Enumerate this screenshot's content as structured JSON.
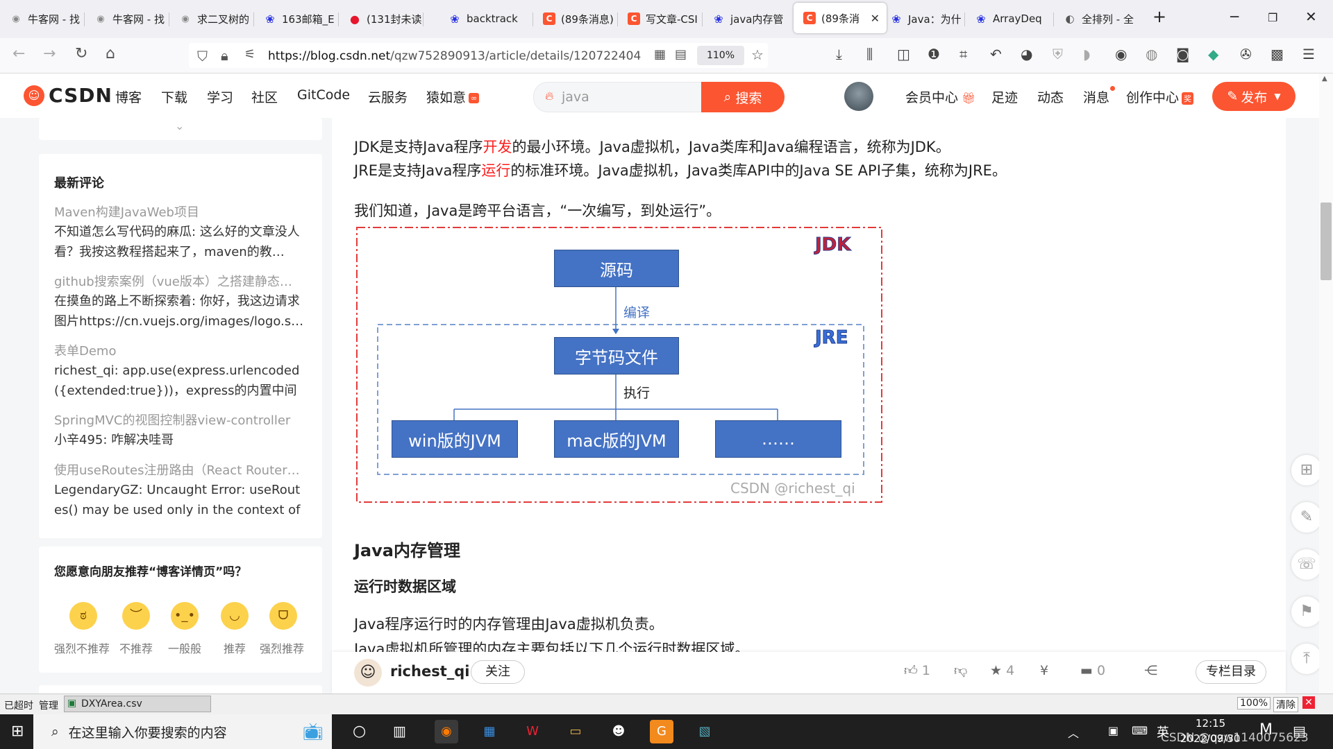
{
  "browser": {
    "tabs": [
      {
        "title": "牛客网 - 找",
        "icon": "nowcoder-icon"
      },
      {
        "title": "牛客网 - 找",
        "icon": "nowcoder-icon"
      },
      {
        "title": "求二叉树的",
        "icon": "nowcoder-icon"
      },
      {
        "title": "163邮箱_Е",
        "icon": "paw-icon"
      },
      {
        "title": "(131封未读",
        "icon": "weibo-icon"
      },
      {
        "title": "backtrack",
        "icon": "paw-icon"
      },
      {
        "title": "(89条消息)",
        "icon": "csdn-icon"
      },
      {
        "title": "写文章-CSI",
        "icon": "csdn-icon"
      },
      {
        "title": "java内存管",
        "icon": "paw-icon"
      },
      {
        "title": "(89条消",
        "icon": "csdn-icon",
        "active": true
      },
      {
        "title": "Java：为什",
        "icon": "paw-icon"
      },
      {
        "title": "ArrayDeq",
        "icon": "paw-icon"
      },
      {
        "title": "全排列 - 全",
        "icon": "nowcoder-icon"
      }
    ],
    "url_host": "https://blog.csdn.net",
    "url_path": "/qzw752890913/article/details/120722404",
    "zoom": "110%"
  },
  "csdn": {
    "logo": "CSDN",
    "nav": [
      "博客",
      "下载",
      "学习",
      "社区",
      "GitCode",
      "云服务",
      "猿如意"
    ],
    "search_placeholder": "java",
    "search_button": "搜索",
    "right_nav": [
      "会员中心",
      "足迹",
      "动态",
      "消息",
      "创作中心"
    ],
    "publish": "发布"
  },
  "sidebar": {
    "comments_title": "最新评论",
    "comments": [
      {
        "title": "Maven构建JavaWeb项目",
        "body": "不知道怎么写代码的麻瓜: 这么好的文章没人看？我按这教程搭起来了，maven的教…"
      },
      {
        "title": "github搜索案例（vue版本）之搭建静态…",
        "body": "在摸鱼的路上不断探索着: 你好，我这边请求图片https://cn.vuejs.org/images/logo.s…"
      },
      {
        "title": "表单Demo",
        "body": "richest_qi: app.use(express.urlencoded({extended:true}))，express的内置中间件也…"
      },
      {
        "title": "SpringMVC的视图控制器view-controller",
        "body": "小辛495: 咋解决哇哥"
      },
      {
        "title": "使用useRoutes注册路由（React Router…",
        "body": "LegendaryGZ: Uncaught Error: useRoutes() may be used only in the context of a <…"
      }
    ],
    "recommend_title": "您愿意向朋友推荐“博客详情页”吗？",
    "ratings": [
      "强烈不推荐",
      "不推荐",
      "一般般",
      "推荐",
      "强烈推荐"
    ]
  },
  "article": {
    "jdk_pre": "JDK是支持Java程序",
    "jdk_red": "开发",
    "jdk_post": "的最小环境。Java虚拟机，Java类库和Java编程语言，统称为JDK。",
    "jre_pre": "JRE是支持Java程序",
    "jre_red": "运行",
    "jre_post": "的标准环境。Java虚拟机，Java类库API中的Java SE API子集，统称为JRE。",
    "cross_platform": "我们知道，Java是跨平台语言，“一次编写，到处运行”。",
    "diagram": {
      "jdk_label": "JDK",
      "jre_label": "JRE",
      "source": "源码",
      "compile": "编译",
      "bytecode": "字节码文件",
      "execute": "执行",
      "jvms": [
        "win版的JVM",
        "mac版的JVM",
        "……"
      ],
      "watermark": "CSDN @richest_qi"
    },
    "h_memory": "Java内存管理",
    "h_runtime": "运行时数据区域",
    "p1": "Java程序运行时的内存管理由Java虚拟机负责。",
    "p2": "Java虚拟机所管理的内存主要包括以下几个运行时数据区域。"
  },
  "author_bar": {
    "name": "richest_qi",
    "follow": "关注",
    "likes": "1",
    "stars": "4",
    "comments": "0",
    "catalog": "专栏目录"
  },
  "downloads": {
    "status": "已超时",
    "manage": "管理",
    "file": "DXYArea.csv",
    "zoom": "100%",
    "clear": "清除"
  },
  "taskbar": {
    "search_placeholder": "在这里输入你要搜索的内容",
    "ime": "英",
    "time": "12:15",
    "date": "2022/09/30",
    "watermark": "CSDN @qzw1140075623"
  }
}
